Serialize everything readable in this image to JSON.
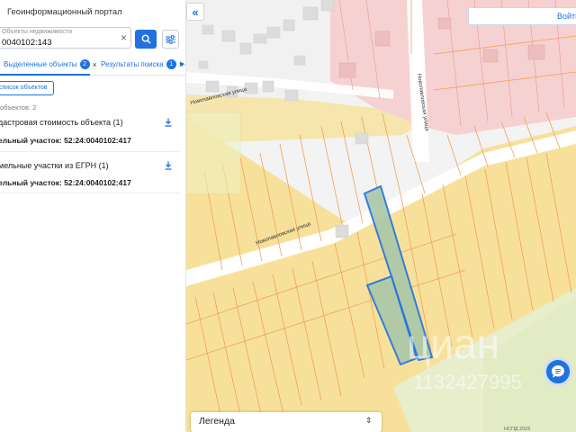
{
  "header": {
    "portal_title": "Геоинформационный портал"
  },
  "search": {
    "label": "Объекты недвижимости",
    "value": "0040102:143",
    "clear_icon": "close-icon",
    "search_icon": "search-icon",
    "filter_icon": "filter-sliders-icon"
  },
  "tabs": [
    {
      "label": "Выделенные объекты",
      "badge": "2",
      "active": true
    },
    {
      "label": "Результаты поиска",
      "badge": "1",
      "active": false
    }
  ],
  "list_button": "список объектов",
  "objects_count": "объектов: 2",
  "sections": [
    {
      "title": "дастровая стоимость объекта (1)",
      "item": "ельный участок: 52:24:0040102:417"
    },
    {
      "title": "мельные участки из ЕГРН (1)",
      "item": "ельный участок: 52:24:0040102:417"
    }
  ],
  "map": {
    "collapse_label": "«",
    "login_label": "Войти",
    "legend_label": "Легенда",
    "legend_toggle": "⌃⌄",
    "streets": [
      "Новопавловская улица",
      "Новопавловская улица",
      "Новопавловская улица"
    ],
    "watermark_brand": "циан",
    "watermark_id": "1132427995",
    "copyright": "НСПД 2025"
  },
  "colors": {
    "accent": "#1f72e0",
    "parcel_fill": "#f7e19a",
    "parcel_stroke": "#f0a15a",
    "pink_zone": "#f6c9c9",
    "selected_parcel": "#a9c7a8",
    "selected_stroke": "#1f72e0"
  }
}
